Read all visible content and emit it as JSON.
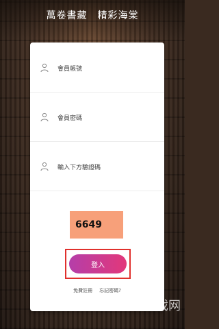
{
  "header": {
    "title": "萬卷書藏　精彩海棠"
  },
  "form": {
    "member_account_placeholder": "會員帳號",
    "member_password_placeholder": "會員密碼",
    "captcha_placeholder": "輸入下方驗證碼"
  },
  "captcha": {
    "code": "6649",
    "bg_color": "#f7a07a"
  },
  "actions": {
    "login_label": "登入",
    "accent_color": "#e2387a"
  },
  "links": {
    "register": "免費註冊",
    "forgot_password": "忘記密碼?"
  },
  "watermark": {
    "text": "游戏网"
  },
  "icons": {
    "user": "user-icon",
    "lock": "user-icon",
    "captcha": "user-icon"
  }
}
